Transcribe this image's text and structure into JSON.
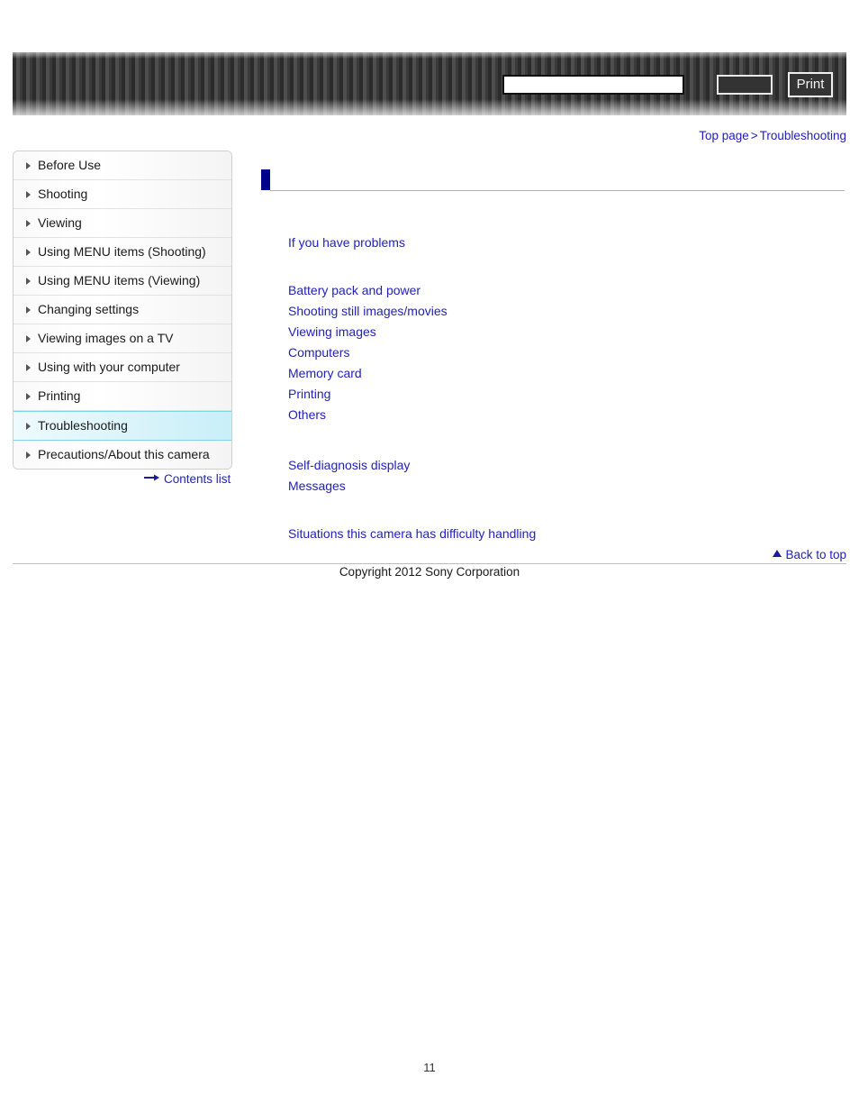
{
  "header": {
    "search": {
      "value": "",
      "placeholder": ""
    },
    "search_button_label": "",
    "print_button_label": "Print"
  },
  "breadcrumb": {
    "top_page": "Top page",
    "separator": ">",
    "current": "Troubleshooting"
  },
  "sidebar": {
    "items": [
      {
        "label": "Before Use",
        "active": false
      },
      {
        "label": "Shooting",
        "active": false
      },
      {
        "label": "Viewing",
        "active": false
      },
      {
        "label": "Using MENU items (Shooting)",
        "active": false
      },
      {
        "label": "Using MENU items (Viewing)",
        "active": false
      },
      {
        "label": "Changing settings",
        "active": false
      },
      {
        "label": "Viewing images on a TV",
        "active": false
      },
      {
        "label": "Using with your computer",
        "active": false
      },
      {
        "label": "Printing",
        "active": false
      },
      {
        "label": "Troubleshooting",
        "active": true
      },
      {
        "label": "Precautions/About this camera",
        "active": false
      }
    ],
    "contents_list_label": "Contents list"
  },
  "main": {
    "page_title": "",
    "group1": [
      {
        "label": "If you have problems"
      }
    ],
    "group2": [
      {
        "label": "Battery pack and power"
      },
      {
        "label": "Shooting still images/movies"
      },
      {
        "label": "Viewing images"
      },
      {
        "label": "Computers"
      },
      {
        "label": "Memory card"
      },
      {
        "label": "Printing"
      },
      {
        "label": "Others"
      }
    ],
    "group3": [
      {
        "label": "Self-diagnosis display"
      },
      {
        "label": "Messages"
      }
    ],
    "group4": [
      {
        "label": "Situations this camera has difficulty handling"
      }
    ]
  },
  "footer": {
    "back_to_top_label": "Back to top",
    "copyright": "Copyright 2012 Sony Corporation",
    "page_number": "11"
  },
  "colors": {
    "link": "#2222bb",
    "title_bar": "#00008f",
    "active_nav": "#c9eff8"
  }
}
